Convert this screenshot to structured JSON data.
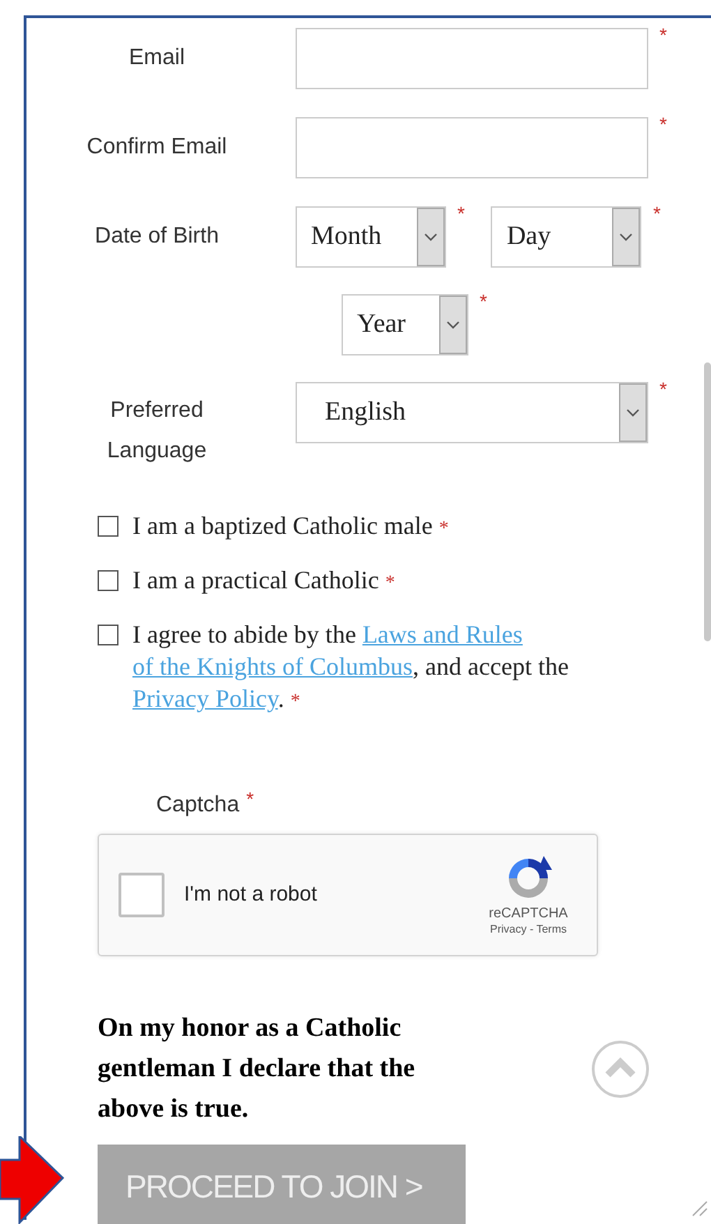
{
  "fields": [
    {
      "kind": "text",
      "label": "Email",
      "asterisk": "*"
    },
    {
      "kind": "text",
      "label": "Confirm Email",
      "asterisk": "*"
    }
  ],
  "date_of_birth": {
    "label": "Date of Birth",
    "selects": [
      {
        "value": "Month",
        "asterisk": "*"
      },
      {
        "value": "Day",
        "asterisk": "*"
      },
      {
        "value": "Year",
        "asterisk": "*"
      }
    ]
  },
  "language": {
    "label": "Preferred Language",
    "value": "English",
    "asterisk": "*"
  },
  "checkboxes": [
    {
      "checked": false,
      "parts": [
        {
          "kind": "text",
          "text": "I am a baptized Catholic male"
        }
      ],
      "asterisk": "*"
    },
    {
      "checked": false,
      "parts": [
        {
          "kind": "text",
          "text": "I am a practical Catholic"
        }
      ],
      "asterisk": "*"
    },
    {
      "checked": false,
      "parts": [
        {
          "kind": "text",
          "text": "I agree to abide by the "
        },
        {
          "kind": "link",
          "text": "Laws and Rules"
        },
        {
          "kind": "link",
          "text": "of the Knights of Columbus"
        },
        {
          "kind": "text",
          "text": ", and accept the "
        },
        {
          "kind": "link",
          "text": "Privacy Policy"
        },
        {
          "kind": "text",
          "text": "."
        }
      ],
      "asterisk": "*"
    }
  ],
  "captcha": {
    "label": "Captcha",
    "asterisk": "*",
    "checkbox_label": "I'm not a robot",
    "checked": false,
    "brand": "reCAPTCHA",
    "links": "Privacy - Terms"
  },
  "declaration": "On my honor as a Catholic gentleman I declare that the above is true.",
  "submit_button": {
    "label": "PROCEED TO JOIN >",
    "disabled": true
  }
}
